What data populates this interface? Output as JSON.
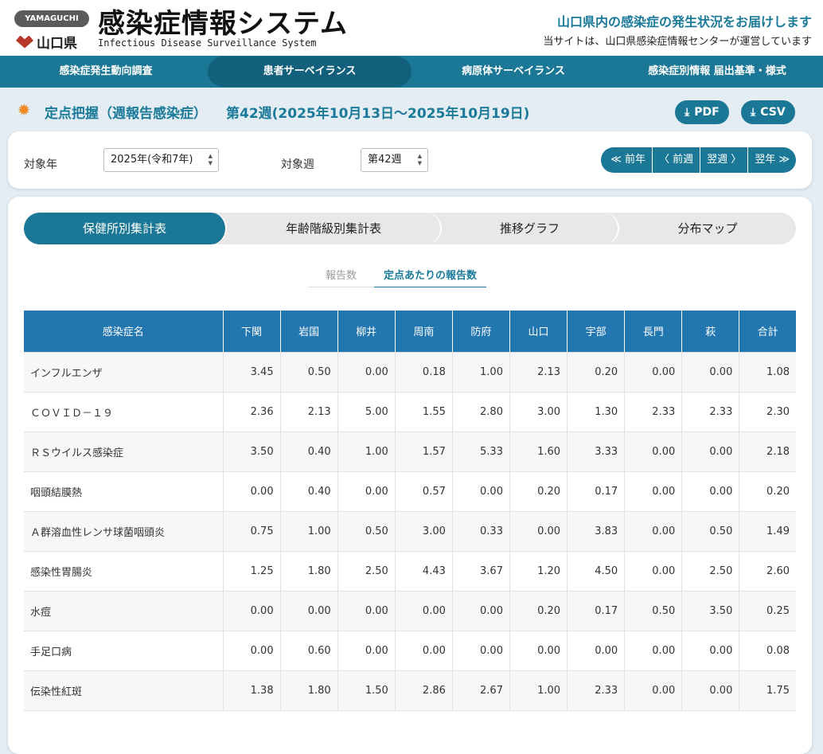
{
  "header": {
    "badge": "YAMAGUCHI",
    "prefecture": "山口県",
    "title": "感染症情報システム",
    "subtitle": "Infectious Disease Surveillance System",
    "tagline": "山口県内の感染症の発生状況をお届けします",
    "operator": "当サイトは、山口県感染症情報センターが運営しています"
  },
  "nav": [
    "感染症発生動向調査",
    "患者サーベイランス",
    "病原体サーベイランス",
    "感染症別情報 届出基準・様式"
  ],
  "page": {
    "title": "定点把握（週報告感染症）",
    "period": "第42週(2025年10月13日〜2025年10月19日)",
    "pdf": "PDF",
    "csv": "CSV"
  },
  "filters": {
    "year_label": "対象年",
    "year_value": "2025年(令和7年)",
    "week_label": "対象週",
    "week_value": "第42週"
  },
  "week_nav": {
    "prev_year": "≪ 前年",
    "prev_week": "〈 前週",
    "next_week": "翌週 〉",
    "next_year": "翌年 ≫"
  },
  "tabs": [
    "保健所別集計表",
    "年齢階級別集計表",
    "推移グラフ",
    "分布マップ"
  ],
  "subtabs": [
    "報告数",
    "定点あたりの報告数"
  ],
  "table": {
    "headers": [
      "感染症名",
      "下関",
      "岩国",
      "柳井",
      "周南",
      "防府",
      "山口",
      "宇部",
      "長門",
      "萩",
      "合計"
    ],
    "rows": [
      [
        "インフルエンザ",
        "3.45",
        "0.50",
        "0.00",
        "0.18",
        "1.00",
        "2.13",
        "0.20",
        "0.00",
        "0.00",
        "1.08"
      ],
      [
        "ＣＯＶＩＤ－１９",
        "2.36",
        "2.13",
        "5.00",
        "1.55",
        "2.80",
        "3.00",
        "1.30",
        "2.33",
        "2.33",
        "2.30"
      ],
      [
        "ＲＳウイルス感染症",
        "3.50",
        "0.40",
        "1.00",
        "1.57",
        "5.33",
        "1.60",
        "3.33",
        "0.00",
        "0.00",
        "2.18"
      ],
      [
        "咽頭結膜熱",
        "0.00",
        "0.40",
        "0.00",
        "0.57",
        "0.00",
        "0.20",
        "0.17",
        "0.00",
        "0.00",
        "0.20"
      ],
      [
        "Ａ群溶血性レンサ球菌咽頭炎",
        "0.75",
        "1.00",
        "0.50",
        "3.00",
        "0.33",
        "0.00",
        "3.83",
        "0.00",
        "0.50",
        "1.49"
      ],
      [
        "感染性胃腸炎",
        "1.25",
        "1.80",
        "2.50",
        "4.43",
        "3.67",
        "1.20",
        "4.50",
        "0.00",
        "2.50",
        "2.60"
      ],
      [
        "水痘",
        "0.00",
        "0.00",
        "0.00",
        "0.00",
        "0.00",
        "0.20",
        "0.17",
        "0.50",
        "3.50",
        "0.25"
      ],
      [
        "手足口病",
        "0.00",
        "0.60",
        "0.00",
        "0.00",
        "0.00",
        "0.00",
        "0.00",
        "0.00",
        "0.00",
        "0.08"
      ],
      [
        "伝染性紅斑",
        "1.38",
        "1.80",
        "1.50",
        "2.86",
        "2.67",
        "1.00",
        "2.33",
        "0.00",
        "0.00",
        "1.75"
      ]
    ]
  }
}
